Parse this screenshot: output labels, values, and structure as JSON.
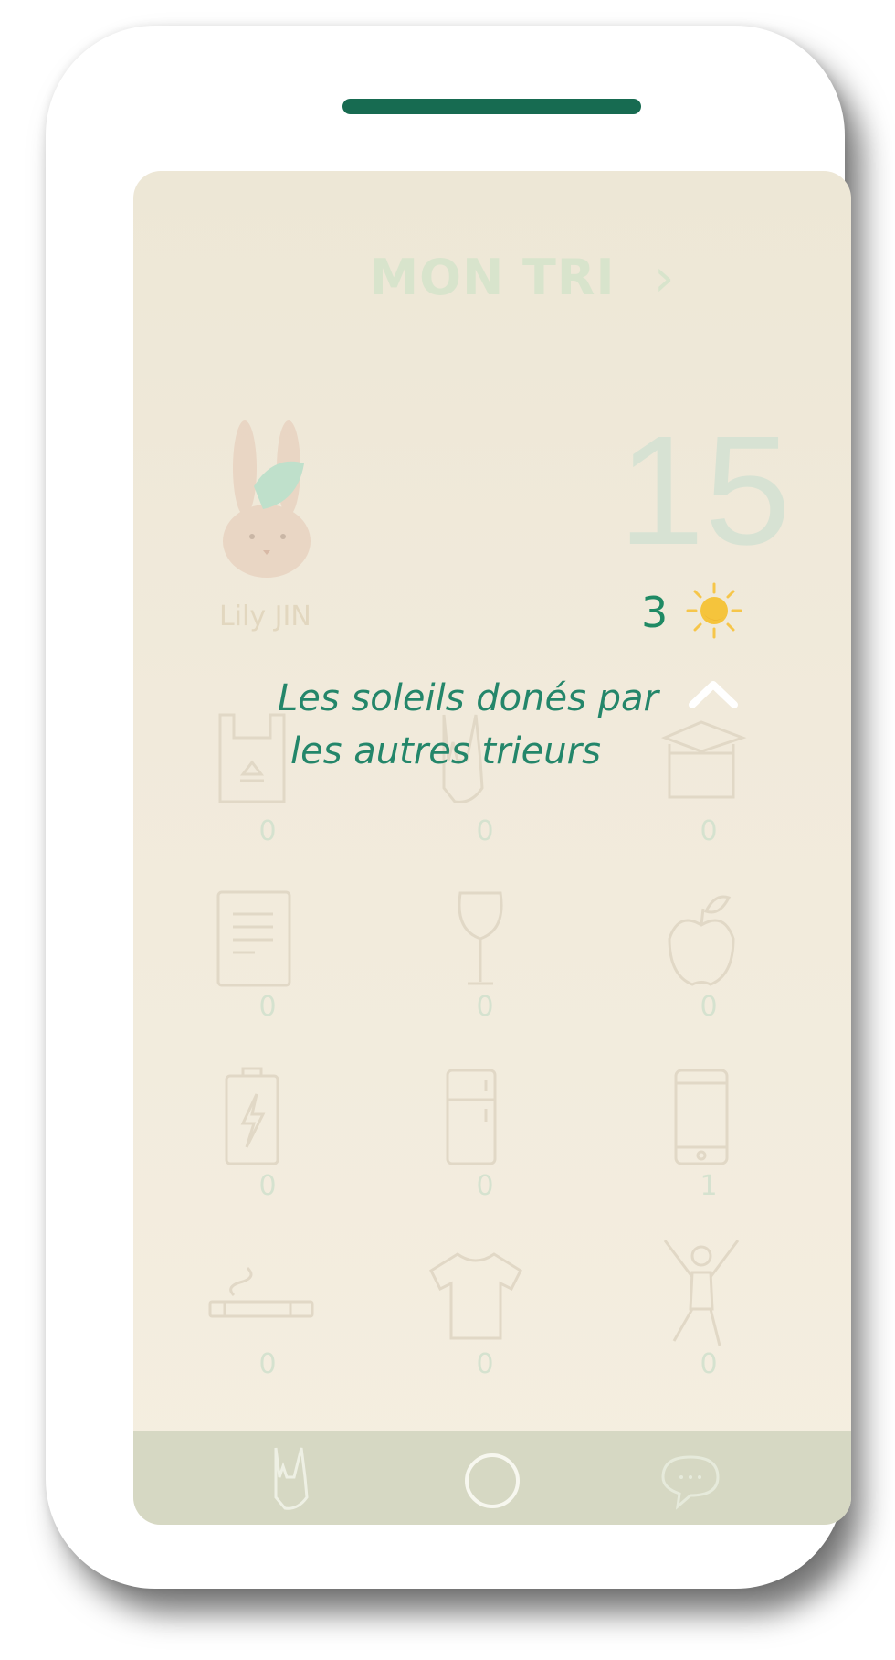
{
  "header": {
    "title": "MON TRI",
    "next_glyph": "›"
  },
  "profile": {
    "name": "Lily JIN",
    "avatar_icon": "rabbit-icon"
  },
  "score": {
    "points": "15",
    "suns": "3",
    "sun_icon": "sun-icon"
  },
  "tooltip": {
    "line1": "Les soleils donés par",
    "line2": "les autres trieurs"
  },
  "categories": [
    {
      "icon": "plastic-bag-icon",
      "count": "0"
    },
    {
      "icon": "rock-hand-icon",
      "count": "0"
    },
    {
      "icon": "cardboard-box-icon",
      "count": "0"
    },
    {
      "icon": "paper-document-icon",
      "count": "0"
    },
    {
      "icon": "wine-glass-icon",
      "count": "0"
    },
    {
      "icon": "apple-icon",
      "count": "0"
    },
    {
      "icon": "battery-icon",
      "count": "0"
    },
    {
      "icon": "fridge-icon",
      "count": "0"
    },
    {
      "icon": "smartphone-icon",
      "count": "1"
    },
    {
      "icon": "cigarette-icon",
      "count": "0"
    },
    {
      "icon": "tshirt-icon",
      "count": "0"
    },
    {
      "icon": "jumping-person-icon",
      "count": "0"
    }
  ],
  "tabbar": {
    "tabs": [
      "rock-hand-icon",
      "home-circle-icon",
      "chat-bubble-icon"
    ]
  },
  "colors": {
    "accent": "#24866a",
    "speaker": "#176b51",
    "tabbar": "#d6d8c3"
  }
}
